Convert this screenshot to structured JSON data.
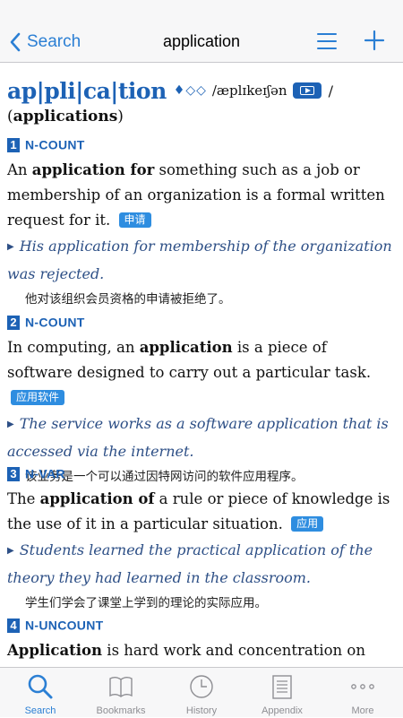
{
  "nav": {
    "back_label": "Search",
    "title": "application"
  },
  "entry": {
    "headword": "ap|pli|ca|tion",
    "frequency": "♦◇◇",
    "pronunciation": "/æplɪkeɪʃən",
    "pronunciation_close": "/",
    "forms_open": "(",
    "forms_word": "applications",
    "forms_close": ")",
    "senses": [
      {
        "num": "1",
        "gram": "N-COUNT",
        "def": [
          {
            "t": "An ",
            "b": false
          },
          {
            "t": "application for",
            "b": true
          },
          {
            "t": " something such as a job or membership of an organization is a formal written request for it.",
            "b": false
          }
        ],
        "tag": "申请",
        "example": "His application for membership of the organization was rejected.",
        "translation": "他对该组织会员资格的申请被拒绝了。"
      },
      {
        "num": "2",
        "gram": "N-COUNT",
        "def": [
          {
            "t": "In computing, an ",
            "b": false
          },
          {
            "t": "application",
            "b": true
          },
          {
            "t": " is a piece of software designed to carry out a particular task.",
            "b": false
          }
        ],
        "tag": "应用软件",
        "example": "The service works as a software application that is accessed via the internet.",
        "translation": "该业务是一个可以通过因特网访问的软件应用程序。"
      },
      {
        "num": "3",
        "gram": "N-VAR",
        "def": [
          {
            "t": "The ",
            "b": false
          },
          {
            "t": "application of",
            "b": true
          },
          {
            "t": " a rule or piece of knowledge is the use of it in a particular situation.",
            "b": false
          }
        ],
        "tag": "应用",
        "example": "Students learned the practical application of the theory they had learned in the classroom.",
        "translation": "学生们学会了课堂上学到的理论的实际应用。"
      },
      {
        "num": "4",
        "gram": "N-UNCOUNT",
        "def": [
          {
            "t": "Application",
            "b": true
          },
          {
            "t": " is hard work and concentration on what you are doing over a period of time.",
            "b": false
          }
        ],
        "tag": "",
        "example": "",
        "translation": ""
      }
    ]
  },
  "tabs": [
    {
      "label": "Search",
      "icon": "search-icon",
      "active": true
    },
    {
      "label": "Bookmarks",
      "icon": "book-icon",
      "active": false
    },
    {
      "label": "History",
      "icon": "clock-icon",
      "active": false
    },
    {
      "label": "Appendix",
      "icon": "document-icon",
      "active": false
    },
    {
      "label": "More",
      "icon": "more-icon",
      "active": false
    }
  ],
  "colors": {
    "accent": "#2b7fd4",
    "headword": "#1d62b5",
    "tag": "#2e8de0",
    "example": "#2d4f86"
  }
}
